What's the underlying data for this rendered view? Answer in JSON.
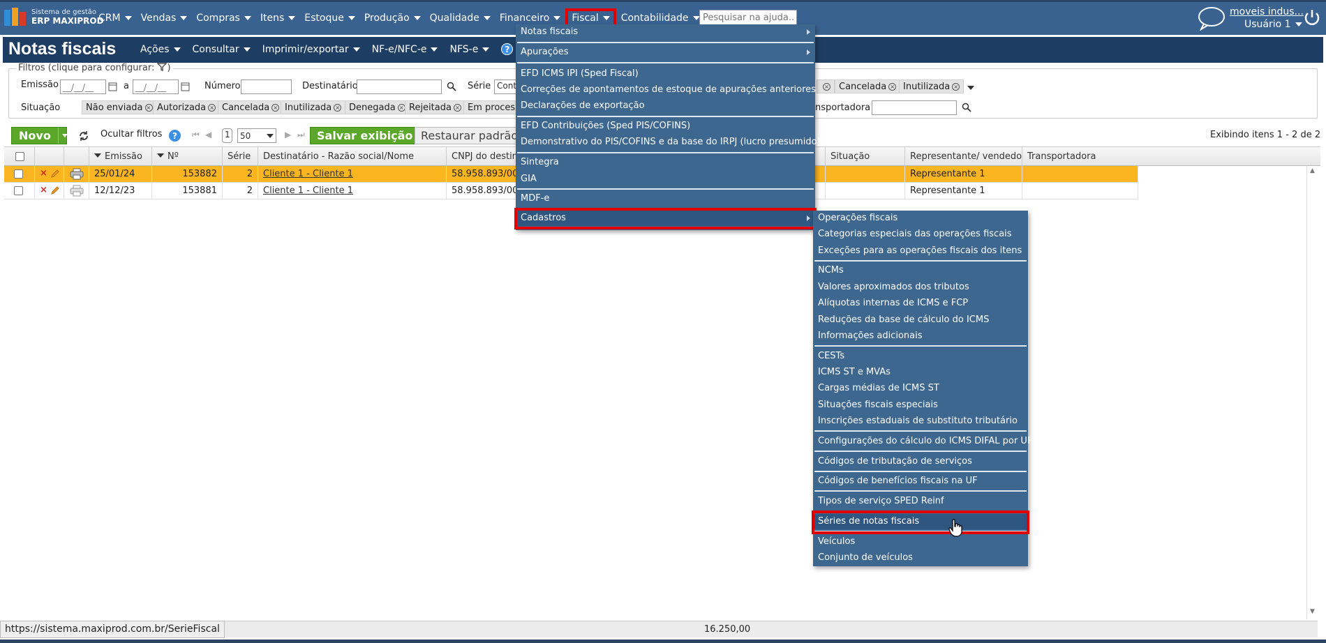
{
  "app": {
    "logo_line1": "Sistema de gestão",
    "logo_line2": "ERP MAXIPROD"
  },
  "nav": {
    "items": [
      "CRM",
      "Vendas",
      "Compras",
      "Itens",
      "Estoque",
      "Produção",
      "Qualidade",
      "Financeiro",
      "Fiscal",
      "Contabilidade"
    ]
  },
  "search": {
    "placeholder": "Pesquisar na ajuda..."
  },
  "user": {
    "company": "moveis indus...",
    "name": "Usuário 1"
  },
  "page": {
    "title": "Notas fiscais",
    "menu": [
      "Ações",
      "Consultar",
      "Imprimir/exportar",
      "NF-e/NFC-e",
      "NFS-e"
    ]
  },
  "filters": {
    "legend": "Filtros (clique para configurar:",
    "emissao_label": "Emissão",
    "date_placeholder": "__/__/__",
    "a_label": "a",
    "numero_label": "Número",
    "destinatario_label": "Destinatário",
    "serie_label": "Série",
    "serie_value": "Cont",
    "situacao_label": "Situação",
    "situacao_chips": [
      "Não enviada",
      "Autorizada",
      "Cancelada",
      "Inutilizada",
      "Denegada",
      "Rejeitada",
      "Em process"
    ],
    "top_chips_partial": "a",
    "top_chips": [
      "Cancelada",
      "Inutilizada"
    ],
    "transportadora_label": "nsportadora"
  },
  "toolbar": {
    "new_label": "Novo",
    "hide_filters": "Ocultar filtros",
    "page": "1",
    "page_size": "50",
    "save_view": "Salvar exibição",
    "restore_default": "Restaurar padrão",
    "count_text": "Exibindo itens 1 - 2 de 2"
  },
  "table": {
    "headers": [
      "Emissão",
      "Nº",
      "Série",
      "Destinatário - Razão social/Nome",
      "CNPJ do destina",
      "Situação",
      "Representante/ vendedor",
      "Transportadora"
    ],
    "rows": [
      {
        "emissao": "25/01/24",
        "numero": "153882",
        "serie": "2",
        "destinatario": "Cliente 1 - Cliente 1",
        "cnpj": "58.958.893/000",
        "representante": "Representante 1"
      },
      {
        "emissao": "12/12/23",
        "numero": "153881",
        "serie": "2",
        "destinatario": "Cliente 1 - Cliente 1",
        "cnpj": "58.958.893/000",
        "representante": "Representante 1"
      }
    ],
    "total": "16.250,00"
  },
  "fiscal_menu": {
    "items": [
      "Notas fiscais",
      "Apurações",
      "EFD ICMS IPI (Sped Fiscal)",
      "Correções de apontamentos de estoque de apurações anteriores",
      "Declarações de exportação",
      "EFD Contribuições (Sped PIS/COFINS)",
      "Demonstrativo do PIS/COFINS e da base do IRPJ (lucro presumido)",
      "Sintegra",
      "GIA",
      "MDF-e",
      "Cadastros"
    ]
  },
  "cadastros_menu": {
    "items": [
      "Operações fiscais",
      "Categorias especiais das operações fiscais",
      "Exceções para as operações fiscais dos itens",
      "NCMs",
      "Valores aproximados dos tributos",
      "Alíquotas internas de ICMS e FCP",
      "Reduções da base de cálculo do ICMS",
      "Informações adicionais",
      "CESTs",
      "ICMS ST e MVAs",
      "Cargas médias de ICMS ST",
      "Situações fiscais especiais",
      "Inscrições estaduais de substituto tributário",
      "Configurações do cálculo do ICMS DIFAL por UF",
      "Códigos de tributação de serviços",
      "Códigos de benefícios fiscais na UF",
      "Tipos de serviço SPED Reinf",
      "Séries de notas fiscais",
      "Veículos",
      "Conjunto de veículos"
    ]
  },
  "status_url": "https://sistema.maxiprod.com.br/SerieFiscal"
}
